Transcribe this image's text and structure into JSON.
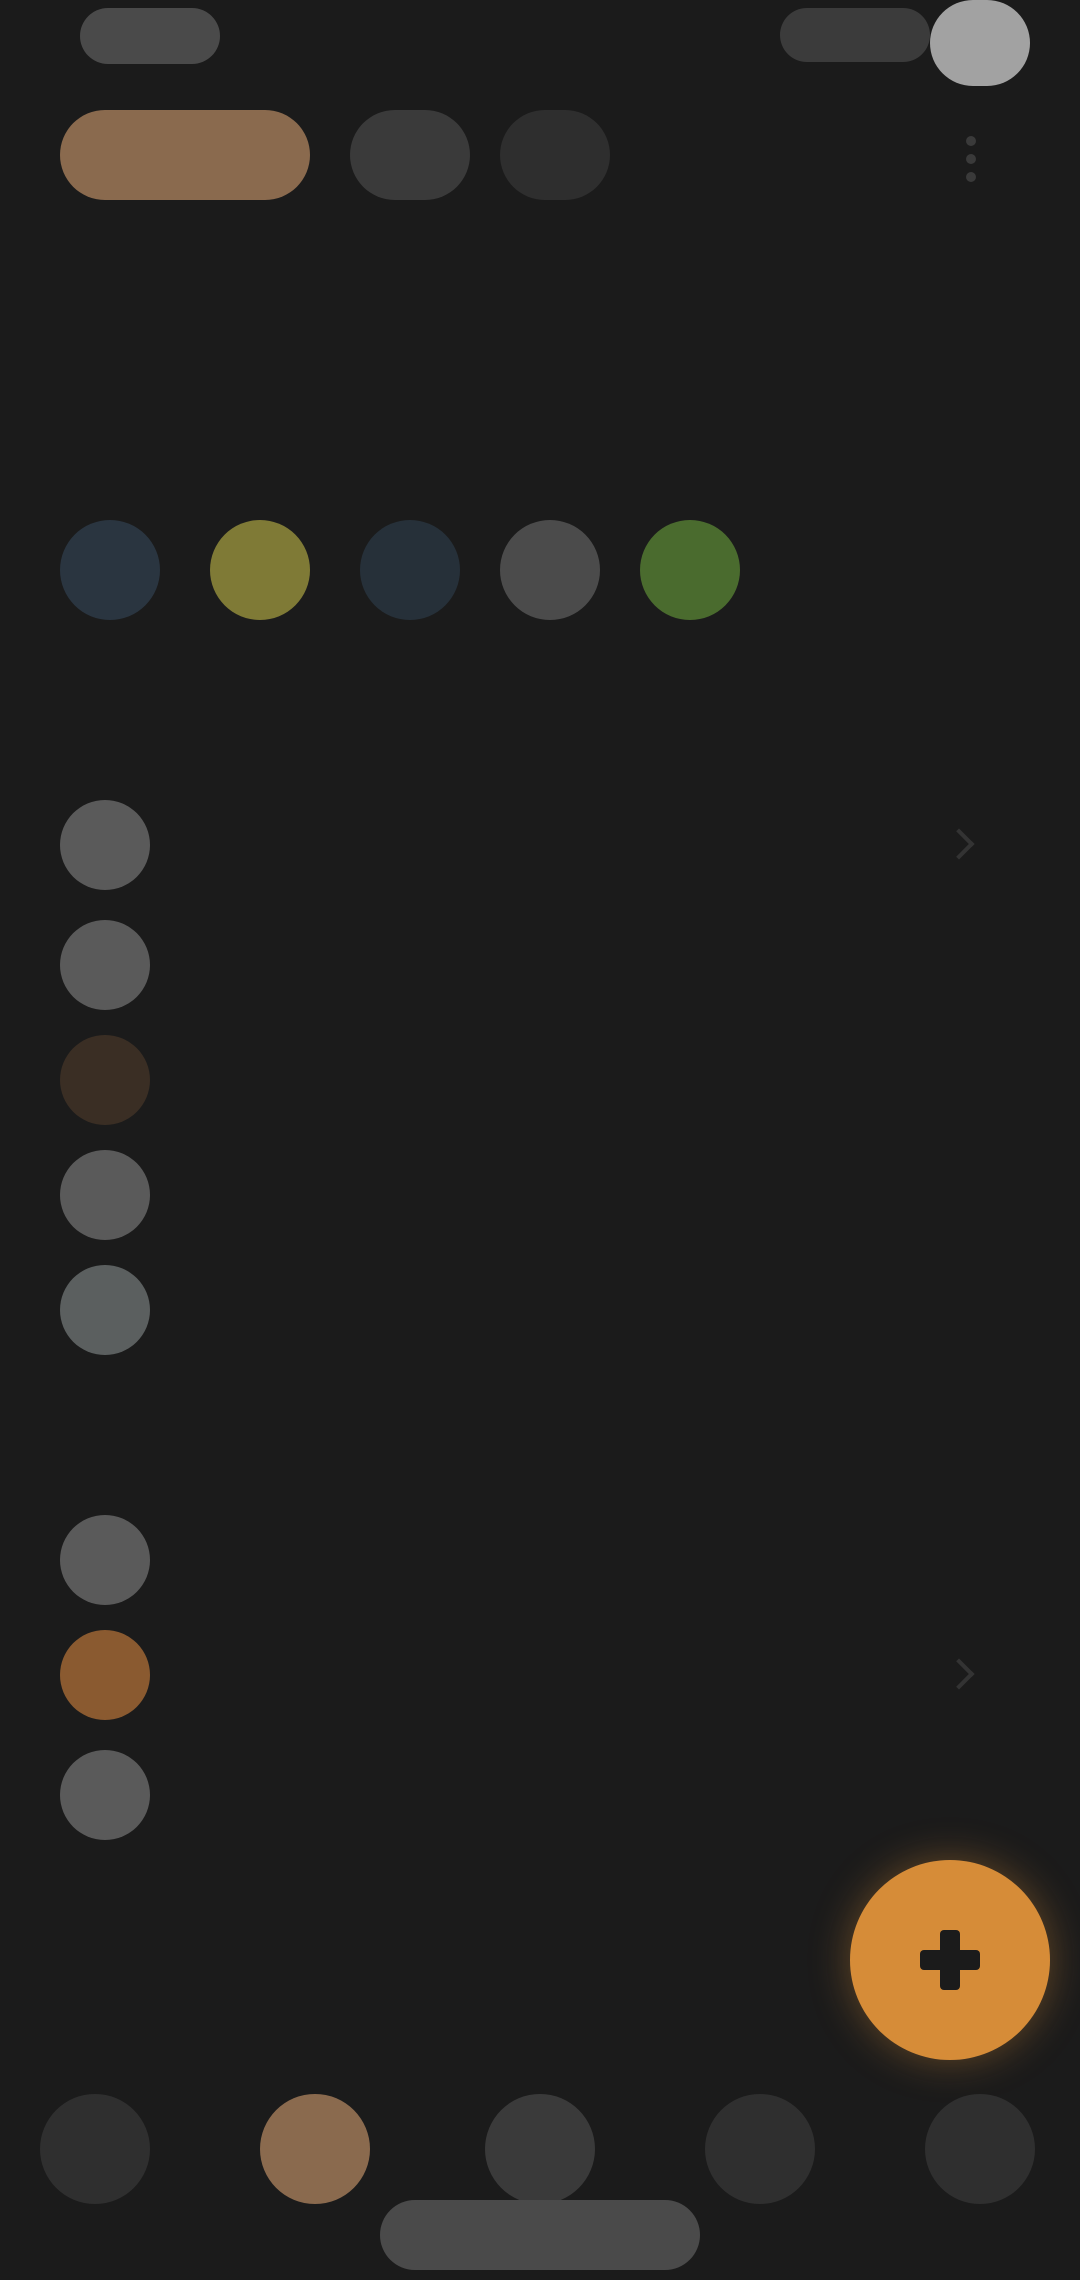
{
  "status_bar": {
    "time": "",
    "battery_color": "#a2a2a2"
  },
  "tabs": [
    {
      "label": "",
      "active": true,
      "color": "#8a6a4e"
    },
    {
      "label": "",
      "active": false
    },
    {
      "label": "",
      "active": false
    }
  ],
  "page": {
    "title": "",
    "colors_label": "",
    "tasks_label": "",
    "other_label": ""
  },
  "swatches": [
    {
      "name": "slate-blue",
      "color": "#2a3540"
    },
    {
      "name": "olive-yellow",
      "color": "#7f7a36"
    },
    {
      "name": "dark-navy",
      "color": "#263039"
    },
    {
      "name": "gray",
      "color": "#4b4b4b"
    },
    {
      "name": "green",
      "color": "#4a6b2e"
    }
  ],
  "tasks": [
    {
      "label": "",
      "icon": "circle-icon",
      "icon_color": "#5a5a5a"
    },
    {
      "label": "",
      "icon": "circle-icon",
      "icon_color": "#5a5a5a"
    },
    {
      "label": "",
      "icon": "circle-icon",
      "icon_color": "#3a2e24"
    },
    {
      "label": "",
      "icon": "circle-icon",
      "icon_color": "#5a5a5a"
    },
    {
      "label": "",
      "icon": "circle-icon",
      "icon_color": "#5b5f5f"
    }
  ],
  "other_items": [
    {
      "label": "",
      "icon": "circle-icon",
      "icon_color": "#5a5a5a"
    },
    {
      "label": "",
      "icon": "circle-icon",
      "icon_color": "#8a5a30"
    },
    {
      "label": "",
      "icon": "circle-icon",
      "icon_color": "#5a5a5a"
    }
  ],
  "fab": {
    "icon": "plus-icon",
    "color": "#d68c38"
  },
  "bottom_nav": [
    {
      "name": "nav-item-1",
      "icon": "circle-icon",
      "color": "#2f2f2f"
    },
    {
      "name": "nav-item-2",
      "icon": "circle-icon",
      "color": "#8a6a4e",
      "active": true
    },
    {
      "name": "nav-item-3",
      "icon": "circle-icon",
      "color": "#3a3a3a"
    },
    {
      "name": "nav-item-4",
      "icon": "circle-icon",
      "color": "#2f2f2f"
    },
    {
      "name": "nav-item-5",
      "icon": "circle-icon",
      "color": "#2f2f2f"
    }
  ]
}
